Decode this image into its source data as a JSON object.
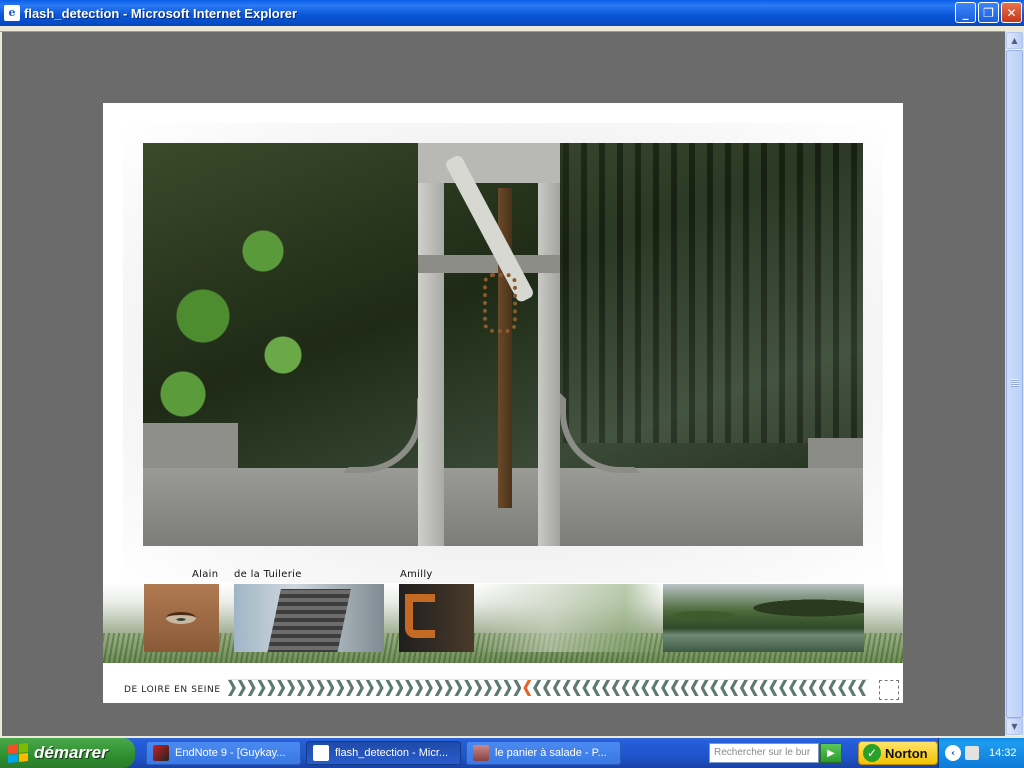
{
  "window": {
    "title": "flash_detection - Microsoft Internet Explorer",
    "icon": "ie-icon",
    "minimize": "_",
    "restore": "❐",
    "close": "✕"
  },
  "viewer": {
    "photo_alt": "sluice gate mechanism over canal",
    "thumbnails": [
      {
        "label": "Alain",
        "name": "thumb-alain"
      },
      {
        "label": "de la Tuilerie",
        "name": "thumb-tuilerie"
      },
      {
        "label": "Amilly",
        "name": "thumb-amilly"
      },
      {
        "label": "",
        "name": "thumb-canal"
      }
    ],
    "nav_title": "DE LOIRE EN SEINE",
    "chevrons_forward": 30,
    "chevrons_back": 34,
    "accent_color": "#e2672c",
    "chevron_color": "#5d7a72"
  },
  "taskbar": {
    "start_label": "démarrer",
    "tasks": [
      {
        "label": "EndNote 9 - [Guykay...",
        "icon": "endnote-icon",
        "active": false
      },
      {
        "label": "flash_detection - Micr...",
        "icon": "ie-icon",
        "active": true
      },
      {
        "label": "le panier à salade - P...",
        "icon": "app-icon",
        "active": false
      }
    ],
    "search_placeholder": "Rechercher sur le bur",
    "norton_label": "Norton",
    "clock": "14:32"
  }
}
